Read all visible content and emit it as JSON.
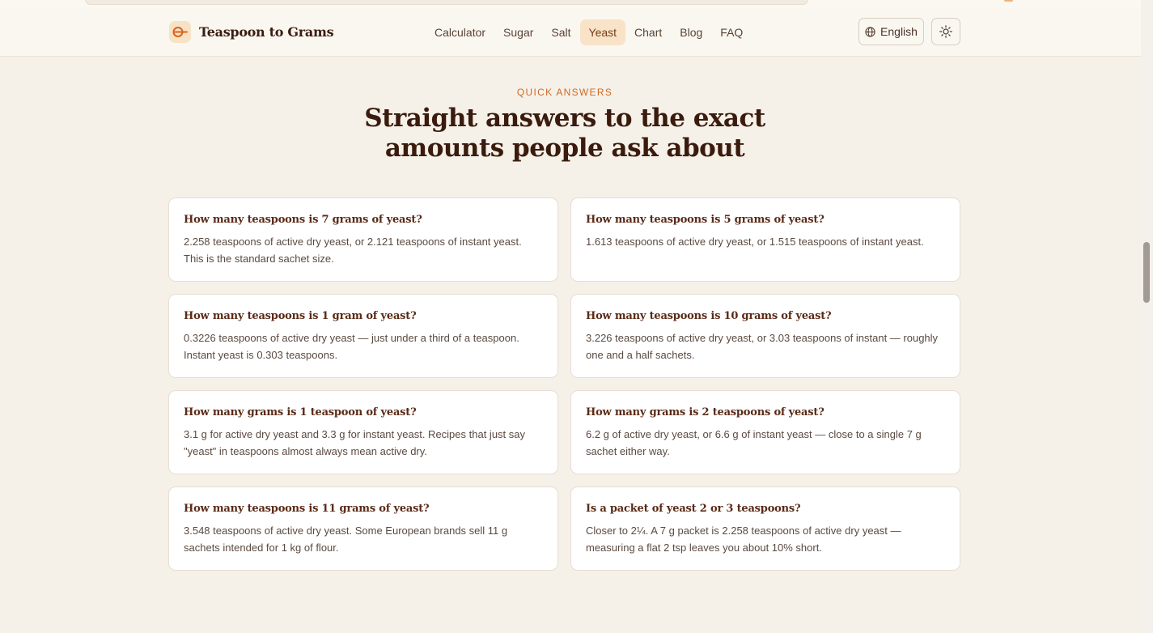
{
  "brand": {
    "name": "Teaspoon to Grams",
    "accent": "#d9641f"
  },
  "nav": [
    "Calculator",
    "Sugar",
    "Salt",
    "Yeast",
    "Chart",
    "Blog",
    "FAQ"
  ],
  "nav_active": "Yeast",
  "language": {
    "label": "English",
    "icon": "globe-icon"
  },
  "theme_toggle": {
    "icon": "sun-icon"
  },
  "section": {
    "eyebrow": "QUICK ANSWERS",
    "title_line1": "Straight answers to the exact",
    "title_line2": "amounts people ask about"
  },
  "faqs": [
    {
      "q": "How many teaspoons is 7 grams of yeast?",
      "a": "2.258 teaspoons of active dry yeast, or 2.121 teaspoons of instant yeast. This is the standard sachet size."
    },
    {
      "q": "How many teaspoons is 5 grams of yeast?",
      "a": "1.613 teaspoons of active dry yeast, or 1.515 teaspoons of instant yeast."
    },
    {
      "q": "How many teaspoons is 1 gram of yeast?",
      "a": "0.3226 teaspoons of active dry yeast — just under a third of a teaspoon. Instant yeast is 0.303 teaspoons."
    },
    {
      "q": "How many teaspoons is 10 grams of yeast?",
      "a": "3.226 teaspoons of active dry yeast, or 3.03 teaspoons of instant — roughly one and a half sachets."
    },
    {
      "q": "How many grams is 1 teaspoon of yeast?",
      "a": "3.1 g for active dry yeast and 3.3 g for instant yeast. Recipes that just say \"yeast\" in teaspoons almost always mean active dry."
    },
    {
      "q": "How many grams is 2 teaspoons of yeast?",
      "a": "6.2 g of active dry yeast, or 6.6 g of instant yeast — close to a single 7 g sachet either way."
    },
    {
      "q": "How many teaspoons is 11 grams of yeast?",
      "a": "3.548 teaspoons of active dry yeast. Some European brands sell 11 g sachets intended for 1 kg of flour."
    },
    {
      "q": "Is a packet of yeast 2 or 3 teaspoons?",
      "a": "Closer to 2¼. A 7 g packet is 2.258 teaspoons of active dry yeast — measuring a flat 2 tsp leaves you about 10% short."
    }
  ]
}
